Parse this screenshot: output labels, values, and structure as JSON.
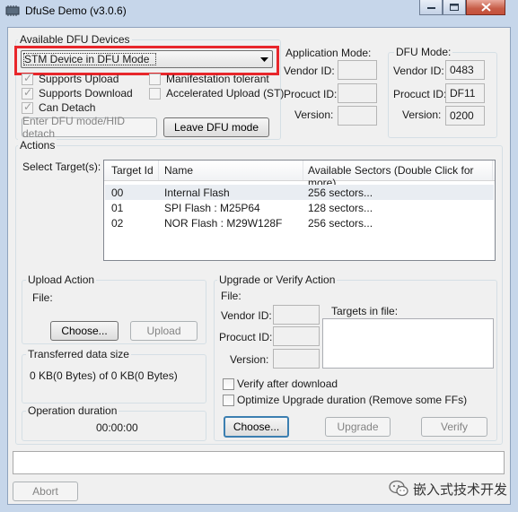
{
  "window": {
    "title": "DfuSe Demo (v3.0.6)"
  },
  "devices": {
    "group_label": "Available DFU Devices",
    "selected_device": "STM Device in DFU Mode",
    "options": [
      {
        "label": "Supports Upload",
        "checked": true
      },
      {
        "label": "Supports Download",
        "checked": true
      },
      {
        "label": "Can Detach",
        "checked": true
      },
      {
        "label": "Manifestation tolerant",
        "checked": false
      },
      {
        "label": "Accelerated Upload (ST)",
        "checked": false
      }
    ],
    "enter_dfu_button": "Enter DFU mode/HID detach",
    "leave_dfu_button": "Leave DFU mode"
  },
  "app_mode": {
    "group_label": "Application Mode:",
    "vendor_id_label": "Vendor ID:",
    "product_id_label": "Procuct ID:",
    "version_label": "Version:",
    "vendor_id": "",
    "product_id": "",
    "version": ""
  },
  "dfu_mode": {
    "group_label": "DFU Mode:",
    "vendor_id_label": "Vendor ID:",
    "product_id_label": "Procuct ID:",
    "version_label": "Version:",
    "vendor_id": "0483",
    "product_id": "DF11",
    "version": "0200"
  },
  "actions": {
    "group_label": "Actions",
    "select_targets_label": "Select Target(s):",
    "columns": [
      "Target Id",
      "Name",
      "Available Sectors (Double Click for more)"
    ],
    "rows": [
      {
        "id": "00",
        "name": "Internal Flash",
        "sectors": "256 sectors..."
      },
      {
        "id": "01",
        "name": "SPI Flash : M25P64",
        "sectors": "128 sectors..."
      },
      {
        "id": "02",
        "name": "NOR Flash : M29W128F",
        "sectors": "256 sectors..."
      }
    ]
  },
  "upload": {
    "group_label": "Upload Action",
    "file_label": "File:",
    "choose_button": "Choose...",
    "upload_button": "Upload"
  },
  "transferred": {
    "group_label": "Transferred data size",
    "value": "0 KB(0 Bytes) of 0 KB(0 Bytes)"
  },
  "duration": {
    "group_label": "Operation duration",
    "value": "00:00:00"
  },
  "upgrade": {
    "group_label": "Upgrade or Verify Action",
    "file_label": "File:",
    "vendor_id_label": "Vendor ID:",
    "product_id_label": "Procuct ID:",
    "version_label": "Version:",
    "targets_in_file_label": "Targets in file:",
    "verify_after_download": {
      "label": "Verify after download",
      "checked": false
    },
    "optimize": {
      "label": "Optimize Upgrade duration (Remove some FFs)",
      "checked": false
    },
    "choose_button": "Choose...",
    "upgrade_button": "Upgrade",
    "verify_button": "Verify"
  },
  "footer": {
    "abort_button": "Abort",
    "watermark": "嵌入式技术开发"
  },
  "colors": {
    "highlight_border": "#e8262b",
    "selected_row": "#e9edf2",
    "title_bar": "#c6d6ea"
  }
}
